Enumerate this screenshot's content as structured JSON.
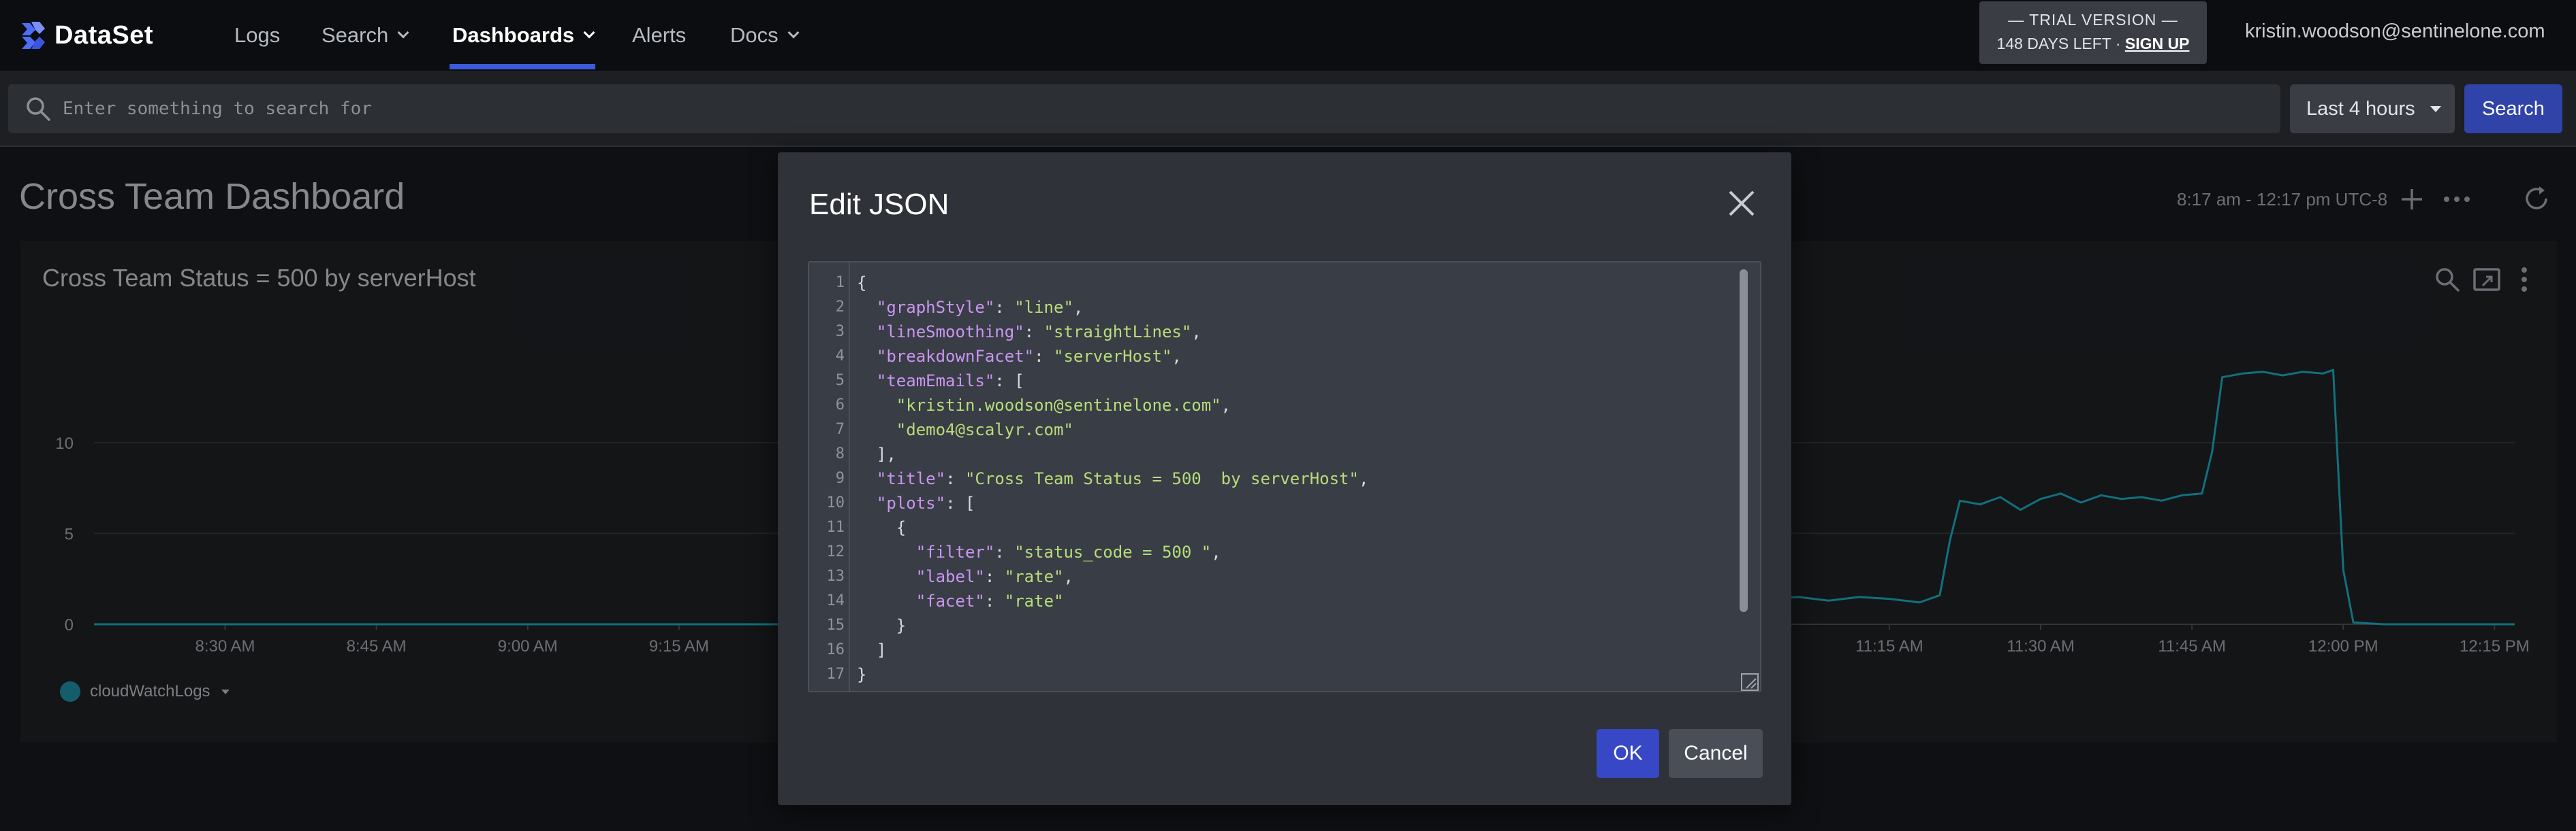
{
  "app": {
    "logo_text": "DataSet"
  },
  "nav": {
    "items": [
      {
        "label": "Logs"
      },
      {
        "label": "Search"
      },
      {
        "label": "Dashboards"
      },
      {
        "label": "Alerts"
      },
      {
        "label": "Docs"
      }
    ],
    "active": "Dashboards"
  },
  "trial": {
    "line1": "— TRIAL VERSION —",
    "days_left": "148 DAYS LEFT · ",
    "signup": "SIGN UP"
  },
  "user": {
    "email": "kristin.woodson@sentinelone.com"
  },
  "search": {
    "placeholder": "Enter something to search for",
    "time_range": "Last 4 hours",
    "button": "Search"
  },
  "dashboard": {
    "title": "Cross Team Dashboard",
    "time_range_text": "8:17 am - 12:17 pm UTC-8"
  },
  "panel": {
    "title": "Cross Team Status = 500 by serverHost",
    "legend_label": "cloudWatchLogs"
  },
  "chart_data": {
    "type": "line",
    "title": "Cross Team Status = 500 by serverHost",
    "xlabel": "",
    "ylabel": "",
    "y_ticks": [
      "0",
      "5",
      "10"
    ],
    "x_ticks_left": [
      "8:30 AM",
      "8:45 AM",
      "9:00 AM",
      "9:15 AM"
    ],
    "x_ticks_right": [
      "11:15 AM",
      "11:30 AM",
      "11:45 AM",
      "12:00 PM",
      "12:15 PM"
    ],
    "ylim": [
      0,
      14
    ],
    "grid": true,
    "legend": "bottom-left",
    "series": [
      {
        "name": "cloudWatchLogs",
        "color": "#1ba6b8",
        "x": [
          "8:17",
          "9:25",
          "11:03",
          "11:06",
          "11:09",
          "11:12",
          "11:15",
          "11:18",
          "11:20",
          "11:21",
          "11:22",
          "11:24",
          "11:26",
          "11:28",
          "11:30",
          "11:32",
          "11:34",
          "11:36",
          "11:38",
          "11:40",
          "11:42",
          "11:44",
          "11:46",
          "11:47",
          "11:48",
          "11:50",
          "11:52",
          "11:54",
          "11:56",
          "11:58",
          "11:59",
          "12:00",
          "12:01",
          "12:04",
          "12:17"
        ],
        "values": [
          0,
          0,
          1.4,
          1.5,
          1.3,
          1.5,
          1.4,
          1.2,
          1.6,
          4.6,
          6.8,
          6.6,
          7.0,
          6.3,
          6.9,
          7.2,
          6.7,
          7.1,
          6.9,
          7.0,
          6.8,
          7.1,
          7.2,
          9.5,
          13.6,
          13.8,
          13.9,
          13.7,
          13.9,
          13.8,
          14.0,
          3.0,
          0.1,
          0,
          0
        ]
      }
    ]
  },
  "modal": {
    "title": "Edit JSON",
    "ok": "OK",
    "cancel": "Cancel",
    "lines": [
      [
        {
          "t": "p",
          "v": "{"
        }
      ],
      [
        {
          "t": "p",
          "v": "  "
        },
        {
          "t": "k",
          "v": "\"graphStyle\""
        },
        {
          "t": "p",
          "v": ": "
        },
        {
          "t": "s",
          "v": "\"line\""
        },
        {
          "t": "p",
          "v": ","
        }
      ],
      [
        {
          "t": "p",
          "v": "  "
        },
        {
          "t": "k",
          "v": "\"lineSmoothing\""
        },
        {
          "t": "p",
          "v": ": "
        },
        {
          "t": "s",
          "v": "\"straightLines\""
        },
        {
          "t": "p",
          "v": ","
        }
      ],
      [
        {
          "t": "p",
          "v": "  "
        },
        {
          "t": "k",
          "v": "\"breakdownFacet\""
        },
        {
          "t": "p",
          "v": ": "
        },
        {
          "t": "s",
          "v": "\"serverHost\""
        },
        {
          "t": "p",
          "v": ","
        }
      ],
      [
        {
          "t": "p",
          "v": "  "
        },
        {
          "t": "k",
          "v": "\"teamEmails\""
        },
        {
          "t": "p",
          "v": ": ["
        }
      ],
      [
        {
          "t": "p",
          "v": "    "
        },
        {
          "t": "s",
          "v": "\"kristin.woodson@sentinelone.com\""
        },
        {
          "t": "p",
          "v": ","
        }
      ],
      [
        {
          "t": "p",
          "v": "    "
        },
        {
          "t": "s",
          "v": "\"demo4@scalyr.com\""
        }
      ],
      [
        {
          "t": "p",
          "v": "  ],"
        }
      ],
      [
        {
          "t": "p",
          "v": "  "
        },
        {
          "t": "k",
          "v": "\"title\""
        },
        {
          "t": "p",
          "v": ": "
        },
        {
          "t": "s",
          "v": "\"Cross Team Status = 500  by serverHost\""
        },
        {
          "t": "p",
          "v": ","
        }
      ],
      [
        {
          "t": "p",
          "v": "  "
        },
        {
          "t": "k",
          "v": "\"plots\""
        },
        {
          "t": "p",
          "v": ": ["
        }
      ],
      [
        {
          "t": "p",
          "v": "    {"
        }
      ],
      [
        {
          "t": "p",
          "v": "      "
        },
        {
          "t": "k",
          "v": "\"filter\""
        },
        {
          "t": "p",
          "v": ": "
        },
        {
          "t": "s",
          "v": "\"status_code = 500 \""
        },
        {
          "t": "p",
          "v": ","
        }
      ],
      [
        {
          "t": "p",
          "v": "      "
        },
        {
          "t": "k",
          "v": "\"label\""
        },
        {
          "t": "p",
          "v": ": "
        },
        {
          "t": "s",
          "v": "\"rate\""
        },
        {
          "t": "p",
          "v": ","
        }
      ],
      [
        {
          "t": "p",
          "v": "      "
        },
        {
          "t": "k",
          "v": "\"facet\""
        },
        {
          "t": "p",
          "v": ": "
        },
        {
          "t": "s",
          "v": "\"rate\""
        }
      ],
      [
        {
          "t": "p",
          "v": "    }"
        }
      ],
      [
        {
          "t": "p",
          "v": "  ]"
        }
      ],
      [
        {
          "t": "p",
          "v": "}"
        }
      ]
    ]
  }
}
